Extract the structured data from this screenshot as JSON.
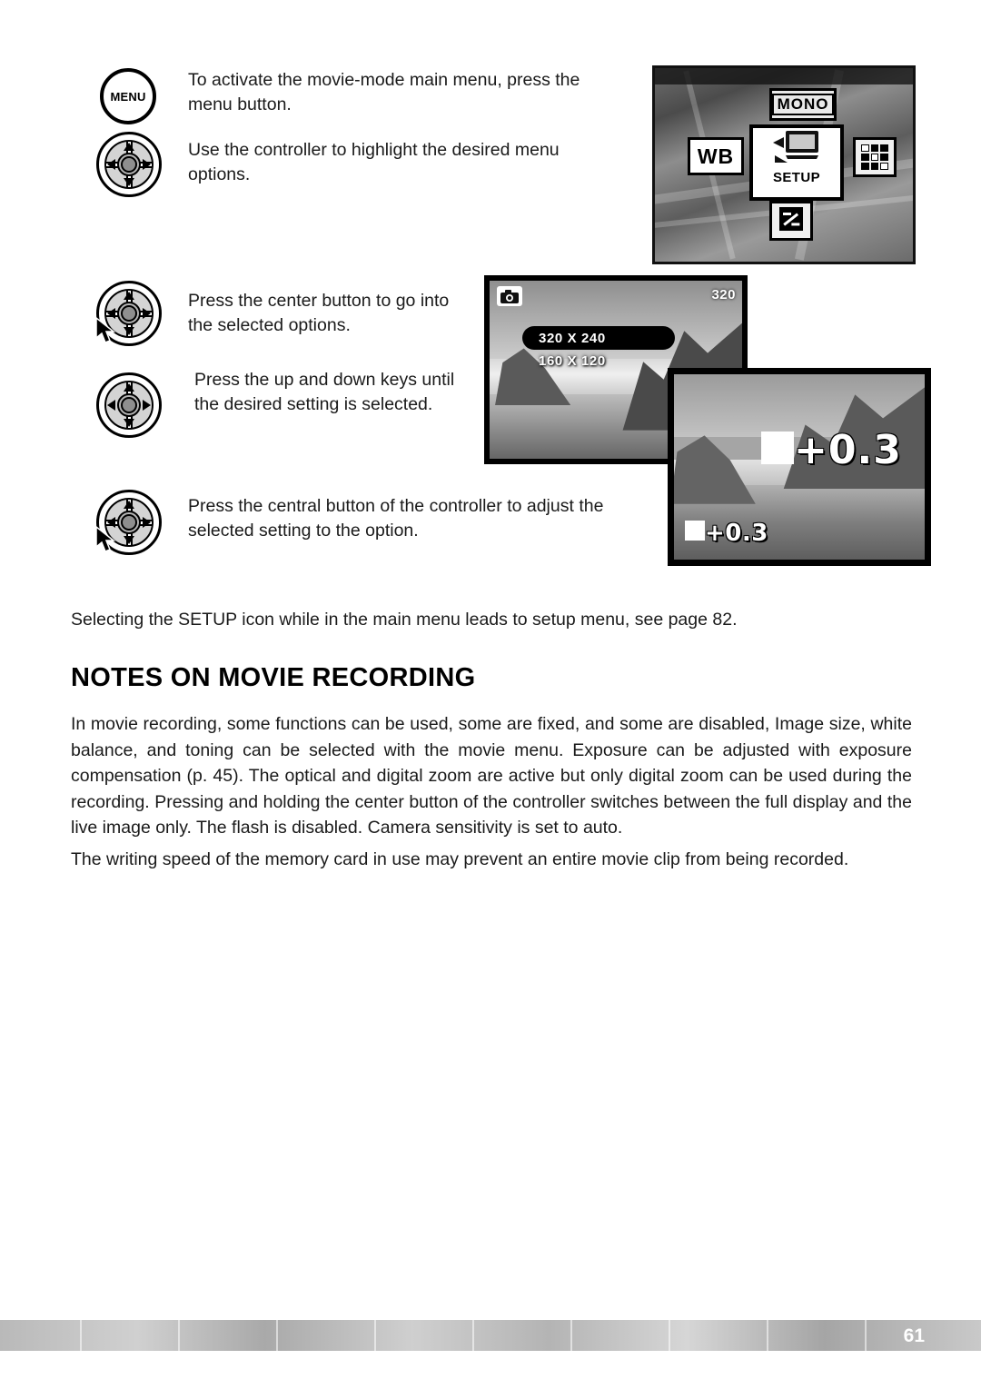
{
  "steps": [
    {
      "icon": "menu-button",
      "text": "To activate the movie-mode main menu, press the menu button."
    },
    {
      "icon": "four-way-controller",
      "text": "Use the controller to highlight the desired menu options."
    },
    {
      "icon": "controller-center-press",
      "text": "Press the center button to go into the selected options."
    },
    {
      "icon": "controller-up-down",
      "text": "Press the up and down keys until the desired setting is selected."
    },
    {
      "icon": "controller-center-press",
      "text": "Press the central button of the controller to adjust the selected setting to the option."
    }
  ],
  "menu_button_label": "MENU",
  "setup_note": "Selecting the SETUP icon while in the main menu leads to setup menu, see page 82.",
  "section": {
    "title": "NOTES ON MOVIE RECORDING",
    "paragraphs": [
      "In movie recording, some functions can be used, some are fixed, and some are disabled, Image size, white balance, and toning can be selected with the movie menu. Exposure can be adjusted with exposure compensation (p. 45). The optical and digital zoom are active but only digital zoom can be used during the recording. Pressing and holding the center button of the controller switches between the full display and the live image only. The flash is disabled. Camera sensitivity is set to auto.",
      "The writing speed of the memory card in use may prevent an entire movie clip from being recorded."
    ]
  },
  "lcd_menu": {
    "tile_wb": "WB",
    "tile_mono": "MONO",
    "tile_setup": "SETUP",
    "tile_grid": "grid-icon",
    "tile_exposure": "exposure-compensation-icon"
  },
  "lcd_size": {
    "mode_icon": "camera-icon",
    "resolution_badge": "320",
    "options": [
      {
        "label": "320 X 240",
        "selected": true
      },
      {
        "label": "160 X 120",
        "selected": false
      }
    ]
  },
  "lcd_exposure": {
    "large_value": "+0.3",
    "small_value": "+0.3",
    "icon": "exposure-compensation-icon"
  },
  "footer": {
    "page_number": "61"
  }
}
